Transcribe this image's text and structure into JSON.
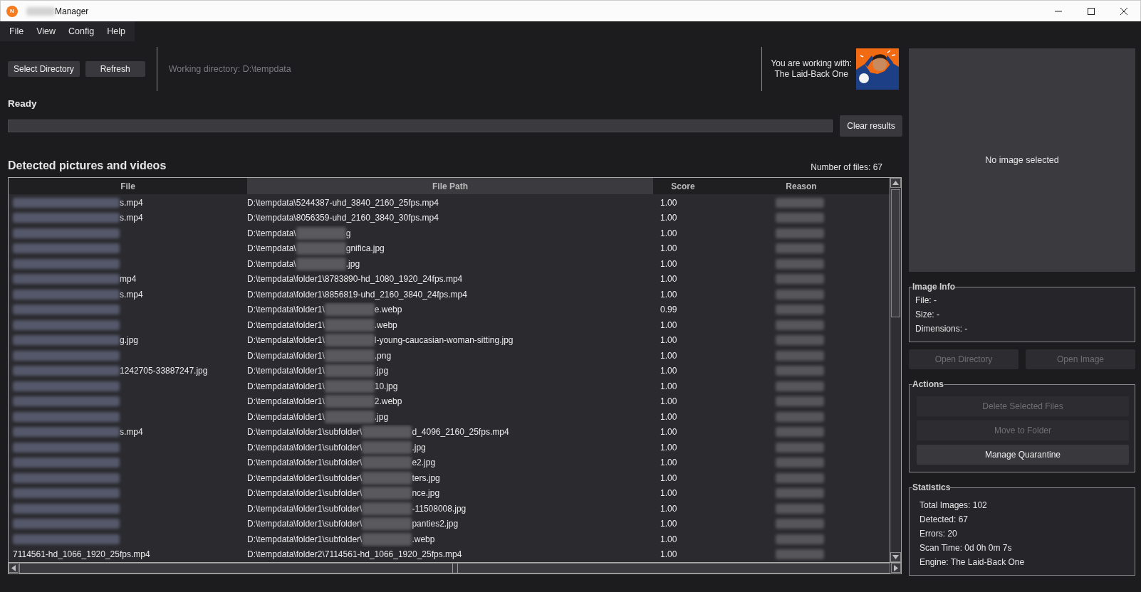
{
  "window": {
    "app_icon_letter": "N",
    "title_redacted": true,
    "title": "Manager"
  },
  "menu": [
    "File",
    "View",
    "Config",
    "Help"
  ],
  "toolbar": {
    "buttons": [
      {
        "label": "Select Directory",
        "disabled": false
      },
      {
        "label": "Refresh",
        "disabled": false
      }
    ],
    "working_directory": "Working directory: D:\\tempdata",
    "engine_caption": "You are working with:",
    "engine_name": "The Laid-Back One"
  },
  "status": "Ready",
  "progress": {
    "level": 0
  },
  "clear_button": "Clear results",
  "results": {
    "heading": "Detected pictures and videos",
    "count": "Number of files: 67",
    "columns": [
      {
        "label": "File",
        "hovered": false
      },
      {
        "label": "File Path",
        "hovered": true
      },
      {
        "label": "Score",
        "hovered": false
      },
      {
        "label": "Reason",
        "hovered": false
      }
    ],
    "rows": [
      {
        "file": {
          "redacted": true,
          "text": "s.mp4"
        },
        "path": {
          "start": "D:\\tempdata\\5244387-uhd_3840_2160_25fps.mp4",
          "redacted": false
        },
        "score": "1.00",
        "reason_redacted": true
      },
      {
        "file": {
          "redacted": true,
          "text": "s.mp4"
        },
        "path": {
          "start": "D:\\tempdata\\8056359-uhd_2160_3840_30fps.mp4",
          "redacted": false
        },
        "score": "1.00",
        "reason_redacted": true
      },
      {
        "file": {
          "redacted": true
        },
        "path": {
          "start": "D:\\tempdata\\",
          "redacted": true,
          "end": "g"
        },
        "score": "1.00",
        "reason_redacted": true
      },
      {
        "file": {
          "redacted": true
        },
        "path": {
          "start": "D:\\tempdata\\",
          "redacted": true,
          "end": "gnifica.jpg"
        },
        "score": "1.00",
        "reason_redacted": true
      },
      {
        "file": {
          "redacted": true
        },
        "path": {
          "start": "D:\\tempdata\\",
          "redacted": true,
          "end": ".jpg"
        },
        "score": "1.00",
        "reason_redacted": true
      },
      {
        "file": {
          "redacted": true,
          "text": "mp4"
        },
        "path": {
          "start": "D:\\tempdata\\folder1\\8783890-hd_1080_1920_24fps.mp4",
          "redacted": false
        },
        "score": "1.00",
        "reason_redacted": true
      },
      {
        "file": {
          "redacted": true,
          "text": "s.mp4"
        },
        "path": {
          "start": "D:\\tempdata\\folder1\\8856819-uhd_2160_3840_24fps.mp4",
          "redacted": false
        },
        "score": "1.00",
        "reason_redacted": true
      },
      {
        "file": {
          "redacted": true
        },
        "path": {
          "start": "D:\\tempdata\\folder1\\",
          "redacted": true,
          "end": "e.webp"
        },
        "score": "0.99",
        "reason_redacted": true
      },
      {
        "file": {
          "redacted": true
        },
        "path": {
          "start": "D:\\tempdata\\folder1\\",
          "redacted": true,
          "end": ".webp"
        },
        "score": "1.00",
        "reason_redacted": true
      },
      {
        "file": {
          "redacted": true,
          "text": "g.jpg"
        },
        "path": {
          "start": "D:\\tempdata\\folder1\\",
          "redacted": true,
          "end": "l-young-caucasian-woman-sitting.jpg"
        },
        "score": "1.00",
        "reason_redacted": true
      },
      {
        "file": {
          "redacted": true
        },
        "path": {
          "start": "D:\\tempdata\\folder1\\",
          "redacted": true,
          "end": ".png"
        },
        "score": "1.00",
        "reason_redacted": true
      },
      {
        "file": {
          "redacted": true,
          "text": "1242705-33887247.jpg"
        },
        "path": {
          "start": "D:\\tempdata\\folder1\\",
          "redacted": true,
          "end": ".jpg"
        },
        "score": "1.00",
        "reason_redacted": true
      },
      {
        "file": {
          "redacted": true
        },
        "path": {
          "start": "D:\\tempdata\\folder1\\",
          "redacted": true,
          "end": "10.jpg"
        },
        "score": "1.00",
        "reason_redacted": true
      },
      {
        "file": {
          "redacted": true
        },
        "path": {
          "start": "D:\\tempdata\\folder1\\",
          "redacted": true,
          "end": "2.webp"
        },
        "score": "1.00",
        "reason_redacted": true
      },
      {
        "file": {
          "redacted": true
        },
        "path": {
          "start": "D:\\tempdata\\folder1\\",
          "redacted": true,
          "end": ".jpg"
        },
        "score": "1.00",
        "reason_redacted": true
      },
      {
        "file": {
          "redacted": true,
          "text": "s.mp4"
        },
        "path": {
          "start": "D:\\tempdata\\folder1\\subfolder\\",
          "redacted": true,
          "end": "d_4096_2160_25fps.mp4"
        },
        "score": "1.00",
        "reason_redacted": true
      },
      {
        "file": {
          "redacted": true
        },
        "path": {
          "start": "D:\\tempdata\\folder1\\subfolder\\",
          "redacted": true,
          "end": ".jpg"
        },
        "score": "1.00",
        "reason_redacted": true
      },
      {
        "file": {
          "redacted": true
        },
        "path": {
          "start": "D:\\tempdata\\folder1\\subfolder\\",
          "redacted": true,
          "end": "e2.jpg"
        },
        "score": "1.00",
        "reason_redacted": true
      },
      {
        "file": {
          "redacted": true
        },
        "path": {
          "start": "D:\\tempdata\\folder1\\subfolder\\",
          "redacted": true,
          "end": "ters.jpg"
        },
        "score": "1.00",
        "reason_redacted": true
      },
      {
        "file": {
          "redacted": true
        },
        "path": {
          "start": "D:\\tempdata\\folder1\\subfolder\\",
          "redacted": true,
          "end": "nce.jpg"
        },
        "score": "1.00",
        "reason_redacted": true
      },
      {
        "file": {
          "redacted": true
        },
        "path": {
          "start": "D:\\tempdata\\folder1\\subfolder\\",
          "redacted": true,
          "end": "-11508008.jpg"
        },
        "score": "1.00",
        "reason_redacted": true
      },
      {
        "file": {
          "redacted": true
        },
        "path": {
          "start": "D:\\tempdata\\folder1\\subfolder\\",
          "redacted": true,
          "end": "panties2.jpg"
        },
        "score": "1.00",
        "reason_redacted": true
      },
      {
        "file": {
          "redacted": true
        },
        "path": {
          "start": "D:\\tempdata\\folder1\\subfolder\\",
          "redacted": true,
          "end": ".webp"
        },
        "score": "1.00",
        "reason_redacted": true
      },
      {
        "file": {
          "redacted": false,
          "text": "7114561-hd_1066_1920_25fps.mp4"
        },
        "path": {
          "start": "D:\\tempdata\\folder2\\7114561-hd_1066_1920_25fps.mp4",
          "redacted": false
        },
        "score": "1.00",
        "reason_redacted": true
      }
    ]
  },
  "preview": {
    "placeholder": "No image selected"
  },
  "image_info": {
    "title": "Image Info",
    "lines": [
      "File: -",
      "Size: -",
      "Dimensions: -"
    ]
  },
  "open_buttons": [
    {
      "label": "Open Directory",
      "disabled": true
    },
    {
      "label": "Open Image",
      "disabled": true
    }
  ],
  "actions": {
    "title": "Actions",
    "buttons": [
      {
        "label": "Delete Selected Files",
        "disabled": true
      },
      {
        "label": "Move to Folder",
        "disabled": true
      },
      {
        "label": "Manage Quarantine",
        "disabled": false
      }
    ]
  },
  "statistics": {
    "title": "Statistics",
    "lines": [
      "Total Images: 102",
      "Detected: 67",
      "Errors: 20",
      "Scan Time: 0d 0h 0m 7s",
      "Engine: The Laid-Back One"
    ]
  }
}
